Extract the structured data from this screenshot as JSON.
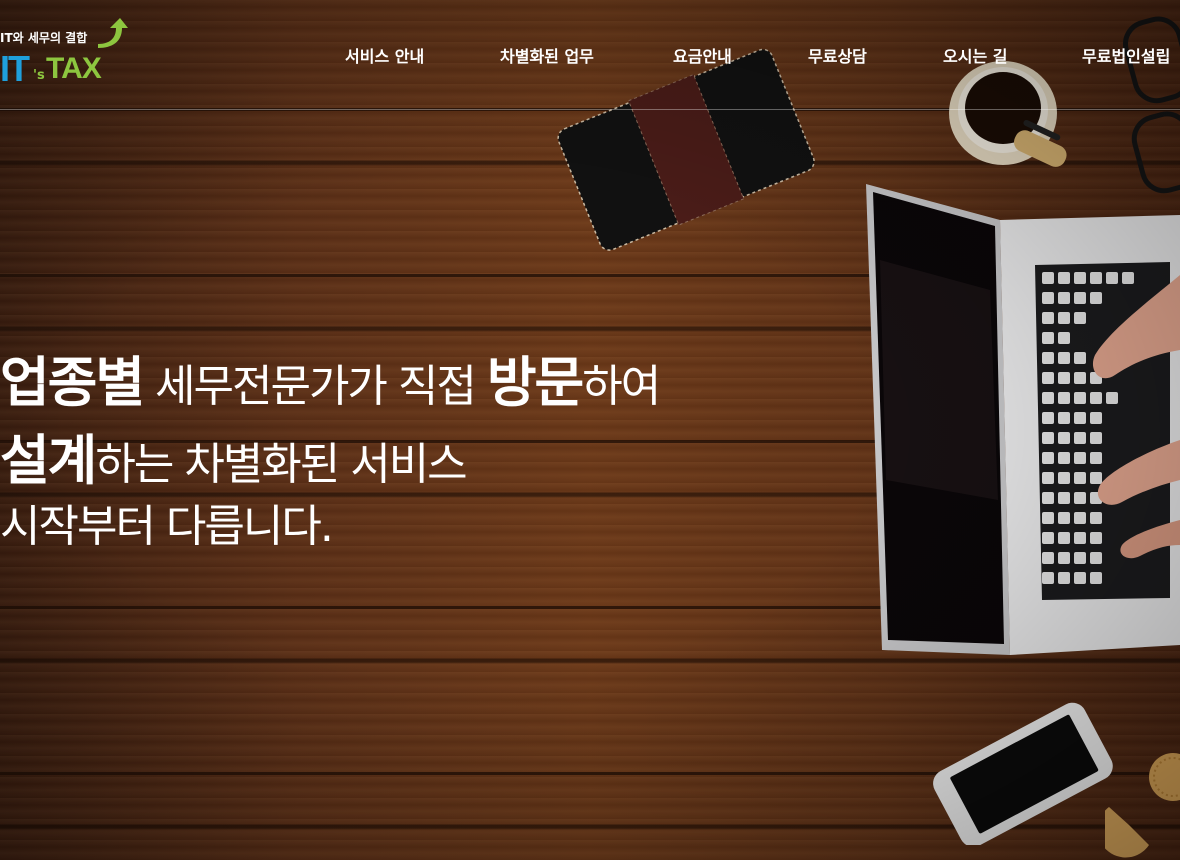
{
  "logo": {
    "tagline": "IT와 세무의 결합",
    "mark_it": "IT",
    "mark_s": "'s",
    "mark_tax": "TAX",
    "colors": {
      "it": "#1fa0dc",
      "tax": "#8dc63f"
    }
  },
  "nav": {
    "items": [
      {
        "label": "서비스 안내"
      },
      {
        "label": "차별화된 업무"
      },
      {
        "label": "요금안내"
      },
      {
        "label": "무료상담"
      },
      {
        "label": "오시는 길"
      },
      {
        "label": "무료법인설립"
      }
    ]
  },
  "hero": {
    "line1": {
      "bold1": "업종별",
      "text1": " 세무전문가가 직접 ",
      "bold2": "방문",
      "text2": "하여"
    },
    "line2": {
      "bold1": "설계",
      "text1": "하는 차별화된 서비스"
    },
    "line3": {
      "text1": "시작부터 다릅니다."
    }
  }
}
